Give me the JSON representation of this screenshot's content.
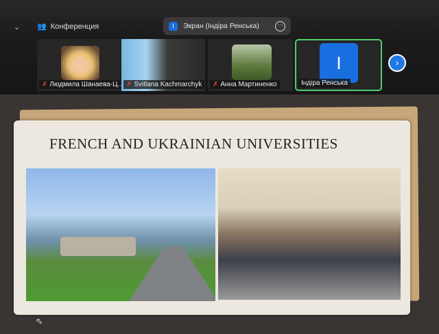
{
  "toolbar": {
    "collapse_icon": "chevron-down",
    "meeting_label": "Конференция",
    "share_label": "Экран (Індіра Ренська)",
    "share_initial": "I"
  },
  "participants": [
    {
      "name": "Людмила Шанаева-Ц...",
      "muted": true
    },
    {
      "name": "Svitlana Kachmarchyk",
      "muted": true
    },
    {
      "name": "Анна Мартиненко",
      "muted": true
    },
    {
      "name": "Індіра Ренська",
      "muted": false,
      "initial": "I",
      "active_speaker": true
    }
  ],
  "slide": {
    "title": "FRENCH  AND  UKRAINIAN UNIVERSITIES"
  },
  "colors": {
    "accent": "#1f7ae6",
    "speaker_border": "#4ccf6a",
    "muted": "#e0453c"
  }
}
